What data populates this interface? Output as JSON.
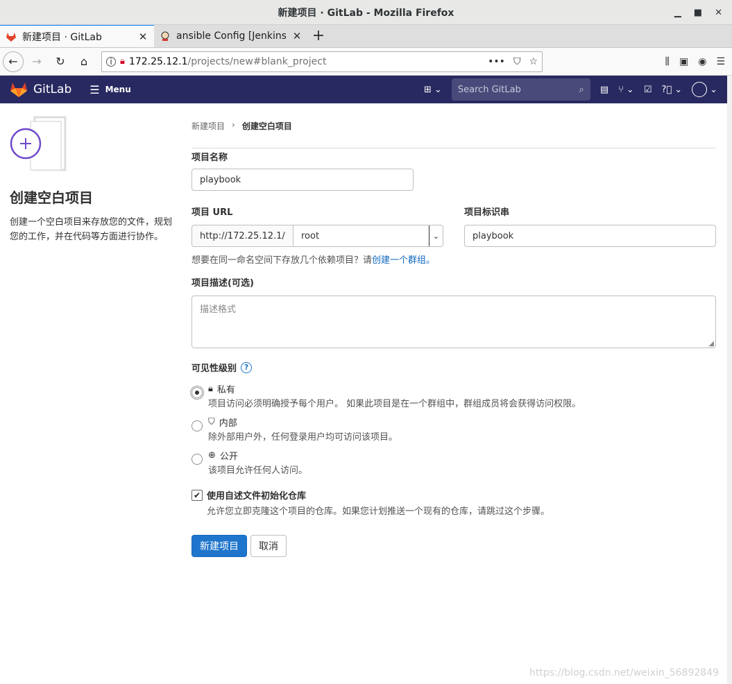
{
  "window": {
    "title": "新建项目 · GitLab - Mozilla Firefox"
  },
  "tabs": [
    {
      "label": "新建项目 · GitLab"
    },
    {
      "label": "ansible Config [Jenkins]"
    }
  ],
  "url": {
    "host": "172.25.12.1",
    "path": "/projects/new#blank_project"
  },
  "gitlab": {
    "brand": "GitLab",
    "menu_label": "Menu",
    "search_placeholder": "Search GitLab"
  },
  "breadcrumb": {
    "parent": "新建项目",
    "current": "创建空白项目"
  },
  "sidebar": {
    "title": "创建空白项目",
    "description": "创建一个空白项目来存放您的文件，规划您的工作，并在代码等方面进行协作。"
  },
  "form": {
    "project_name_label": "项目名称",
    "project_name_value": "playbook",
    "project_url_label": "项目 URL",
    "url_prefix": "http://172.25.12.1/",
    "namespace_value": "root",
    "slug_label": "项目标识串",
    "slug_value": "playbook",
    "group_hint_prefix": "想要在同一命名空间下存放几个依赖项目？请",
    "group_hint_link": "创建一个群组。",
    "description_label": "项目描述(可选)",
    "description_placeholder": "描述格式",
    "visibility_label": "可见性级别",
    "visibility_options": [
      {
        "title": "私有",
        "desc": "项目访问必须明确授予每个用户。 如果此项目是在一个群组中，群组成员将会获得访问权限。",
        "checked": true
      },
      {
        "title": "内部",
        "desc": "除外部用户外，任何登录用户均可访问该项目。",
        "checked": false
      },
      {
        "title": "公开",
        "desc": "该项目允许任何人访问。",
        "checked": false
      }
    ],
    "init_readme_label": "使用自述文件初始化仓库",
    "init_readme_desc": "允许您立即克隆这个项目的仓库。如果您计划推送一个现有的仓库，请跳过这个步骤。",
    "submit_label": "新建项目",
    "cancel_label": "取消"
  },
  "watermark": "https://blog.csdn.net/weixin_56892849",
  "colors": {
    "header_bg": "#292961",
    "primary": "#1f75cb",
    "link": "#1068bf"
  }
}
